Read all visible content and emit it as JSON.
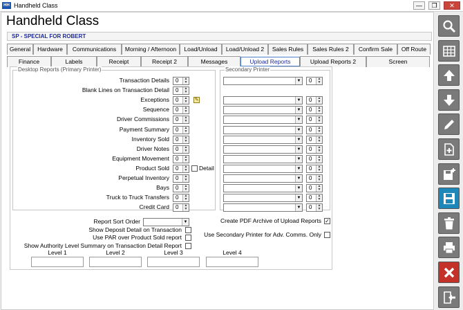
{
  "window": {
    "app_icon_text": "HH",
    "title": "Handheld Class",
    "controls": {
      "minimize": "—",
      "restore": "❐",
      "close": "✕"
    }
  },
  "form": {
    "title": "Handheld Class",
    "customer": "SP - SPECIAL FOR ROBERT"
  },
  "tabs_row1": [
    "General",
    "Hardware",
    "Communications",
    "Morning / Afternoon",
    "Load/Unload",
    "Load/Unload 2",
    "Sales Rules",
    "Sales Rules 2",
    "Confirm Sale",
    "Off Route"
  ],
  "tabs_row2": [
    "Finance",
    "Labels",
    "Receipt",
    "Receipt 2",
    "Messages",
    "Upload Reports",
    "Upload Reports 2",
    "Screen"
  ],
  "active_tab": "Upload Reports",
  "desktop_group": {
    "title": "Desktop Reports (Primary Printer)",
    "rows": [
      {
        "label": "Transaction Details",
        "value": "0"
      },
      {
        "label": "Blank Lines on Transaction Detail",
        "value": "0"
      },
      {
        "label": "Exceptions",
        "value": "0"
      },
      {
        "label": "Sequence",
        "value": "0"
      },
      {
        "label": "Driver Commissions",
        "value": "0"
      },
      {
        "label": "Payment Summary",
        "value": "0"
      },
      {
        "label": "Inventory Sold",
        "value": "0"
      },
      {
        "label": "Driver Notes",
        "value": "0"
      },
      {
        "label": "Equipment Movement",
        "value": "0"
      },
      {
        "label": "Product Sold",
        "value": "0"
      },
      {
        "label": "Perpetual Inventory",
        "value": "0"
      },
      {
        "label": "Bays",
        "value": "0"
      },
      {
        "label": "Truck to Truck Transfers",
        "value": "0"
      },
      {
        "label": "Credit Card",
        "value": "0"
      }
    ],
    "product_sold_detail_label": "Detail",
    "exceptions_icon": "note-icon"
  },
  "secondary_group": {
    "title": "Secondary Printer",
    "rows": [
      {
        "printer": "",
        "value": "0"
      },
      {
        "printer": "",
        "value": "0"
      },
      {
        "printer": "",
        "value": "0"
      },
      {
        "printer": "",
        "value": "0"
      },
      {
        "printer": "",
        "value": "0"
      },
      {
        "printer": "",
        "value": "0"
      },
      {
        "printer": "",
        "value": "0"
      },
      {
        "printer": "",
        "value": "0"
      },
      {
        "printer": "",
        "value": "0"
      },
      {
        "printer": "",
        "value": "0"
      },
      {
        "printer": "",
        "value": "0"
      },
      {
        "printer": "",
        "value": "0"
      },
      {
        "printer": "",
        "value": "0"
      }
    ]
  },
  "options": {
    "report_sort_order_label": "Report Sort Order",
    "report_sort_order_value": "",
    "show_deposit_label": "Show Deposit Detail on Transaction",
    "show_deposit_checked": false,
    "use_par_label": "Use PAR over Product Sold report",
    "use_par_checked": false,
    "create_pdf_label": "Create PDF Archive of Upload Reports",
    "create_pdf_checked": true,
    "use_secondary_label": "Use Secondary Printer for Adv. Comms. Only",
    "use_secondary_checked": false,
    "authority_label": "Show Authority Level Summary on Transaction Detail Report",
    "authority_checked": false
  },
  "levels": [
    {
      "label": "Level 1",
      "value": ""
    },
    {
      "label": "Level 2",
      "value": ""
    },
    {
      "label": "Level 3",
      "value": ""
    },
    {
      "label": "Level 4",
      "value": ""
    }
  ],
  "toolbar": [
    {
      "icon": "search-icon",
      "color": "#7a7a7a"
    },
    {
      "icon": "grid-icon",
      "color": "#7a7a7a"
    },
    {
      "icon": "arrow-up-icon",
      "color": "#7a7a7a"
    },
    {
      "icon": "arrow-down-icon",
      "color": "#7a7a7a"
    },
    {
      "icon": "pencil-icon",
      "color": "#7a7a7a"
    },
    {
      "icon": "new-document-icon",
      "color": "#7a7a7a"
    },
    {
      "icon": "save-new-icon",
      "color": "#7a7a7a"
    },
    {
      "icon": "save-icon",
      "color": "#1c87b8"
    },
    {
      "icon": "trash-icon",
      "color": "#7a7a7a"
    },
    {
      "icon": "printer-icon",
      "color": "#7a7a7a"
    },
    {
      "icon": "delete-x-icon",
      "color": "#c43128"
    },
    {
      "icon": "exit-icon",
      "color": "#7a7a7a"
    }
  ]
}
